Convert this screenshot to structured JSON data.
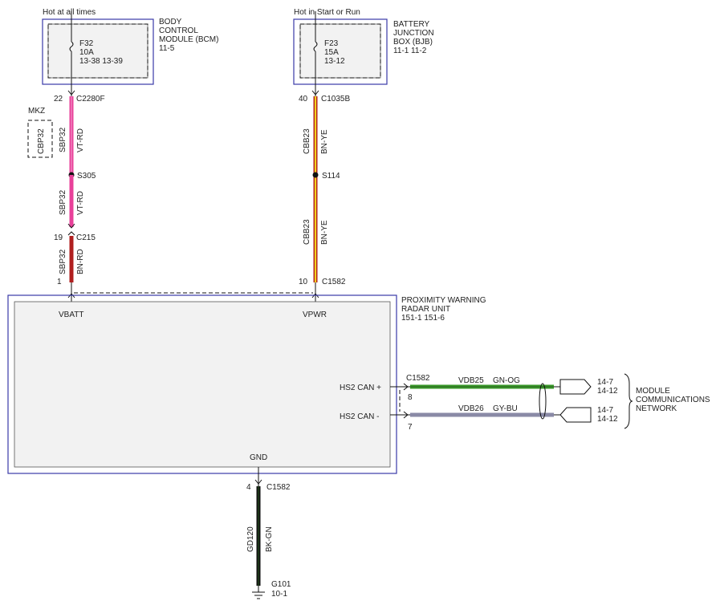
{
  "colors": {
    "vt_rd": "#e8409a",
    "bn_rd": "#b01f1f",
    "bn_ye_outer": "#b3261e",
    "bn_ye_inner": "#f2d21b",
    "gn_og": "#3a9a2a",
    "gy_bu": "#8a8aa6",
    "bk_gn": "#111111",
    "box_border": "#3a3aa8"
  },
  "top_left": {
    "supply_label": "Hot at all times",
    "module_name": [
      "BODY",
      "CONTROL",
      "MODULE (BCM)",
      "11-5"
    ],
    "fuse": [
      "F32",
      "10A",
      "13-38   13-39"
    ],
    "pin": "22",
    "connector": "C2280F",
    "option_label": "MKZ",
    "option_circuit": "CBP32",
    "circuit_1": "SBP32",
    "color_1": "VT-RD",
    "splice": "S305",
    "circuit_2": "SBP32",
    "color_2": "VT-RD",
    "inline_pin": "19",
    "inline_connector": "C215",
    "circuit_3": "SBP32",
    "color_3": "BN-RD",
    "module_pin": "1"
  },
  "top_right": {
    "supply_label": "Hot in Start or Run",
    "module_name": [
      "BATTERY",
      "JUNCTION",
      "BOX (BJB)",
      "11-1     11-2"
    ],
    "fuse": [
      "F23",
      "15A",
      "13-12"
    ],
    "pin": "40",
    "connector": "C1035B",
    "circuit_1": "CBB23",
    "color_1": "BN-YE",
    "splice": "S114",
    "circuit_2": "CBB23",
    "color_2": "BN-YE",
    "module_pin": "10",
    "module_connector": "C1582"
  },
  "radar": {
    "title": [
      "PROXIMITY WARNING",
      "RADAR UNIT",
      "151-1   151-6"
    ],
    "pin_vbatt": "VBATT",
    "pin_vpwr": "VPWR",
    "pin_can_plus": "HS2 CAN +",
    "pin_can_minus": "HS2 CAN -",
    "pin_gnd": "GND"
  },
  "can": {
    "connector": "C1582",
    "plus_pin": "8",
    "minus_pin": "7",
    "plus_circuit": "VDB25",
    "plus_color": "GN-OG",
    "minus_circuit": "VDB26",
    "minus_color": "GY-BU",
    "plus_ref": [
      "14-7",
      "14-12"
    ],
    "minus_ref": [
      "14-7",
      "14-12"
    ],
    "network_label": [
      "MODULE",
      "COMMUNICATIONS",
      "NETWORK"
    ]
  },
  "ground": {
    "pin": "4",
    "connector": "C1582",
    "circuit": "GD120",
    "color": "BK-GN",
    "ground_point": "G101",
    "ground_ref": "10-1"
  }
}
